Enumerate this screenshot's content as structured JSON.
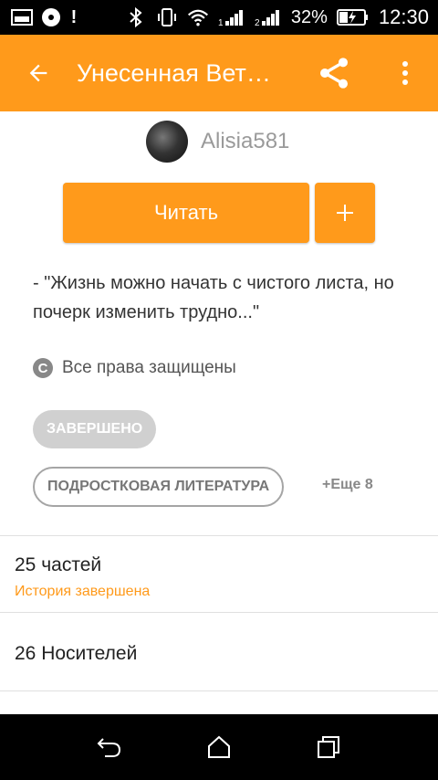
{
  "status_bar": {
    "battery_percent": "32%",
    "time": "12:30",
    "icons": [
      "image-icon",
      "disc-icon",
      "alert-icon",
      "bluetooth-icon",
      "vibrate-icon",
      "wifi-icon",
      "signal-1-icon",
      "signal-2-icon",
      "battery-charging-icon"
    ]
  },
  "toolbar": {
    "title": "Унесенная Вет…",
    "back_icon": "back-arrow-icon",
    "share_icon": "share-icon",
    "more_icon": "more-vert-icon"
  },
  "author": {
    "name": "Alisia581"
  },
  "actions": {
    "read_label": "Читать",
    "add_label": "+"
  },
  "description": "- \"Жизнь можно начать с чистого листа, но почерк изменить трудно...\"",
  "rights": {
    "icon_letter": "C",
    "text": "Все права защищены"
  },
  "status_badge": "ЗАВЕРШЕНО",
  "tags": {
    "primary": "ПОДРОСТКОВАЯ ЛИТЕРАТУРА",
    "more": "+Еще 8"
  },
  "stats": {
    "parts": "25 частей",
    "parts_sub": "История завершена",
    "carriers": "26 Носителей"
  },
  "colors": {
    "accent": "#FF9A1B",
    "badge_bg": "#D0D0D0",
    "tag_border": "#A5A5A5"
  }
}
